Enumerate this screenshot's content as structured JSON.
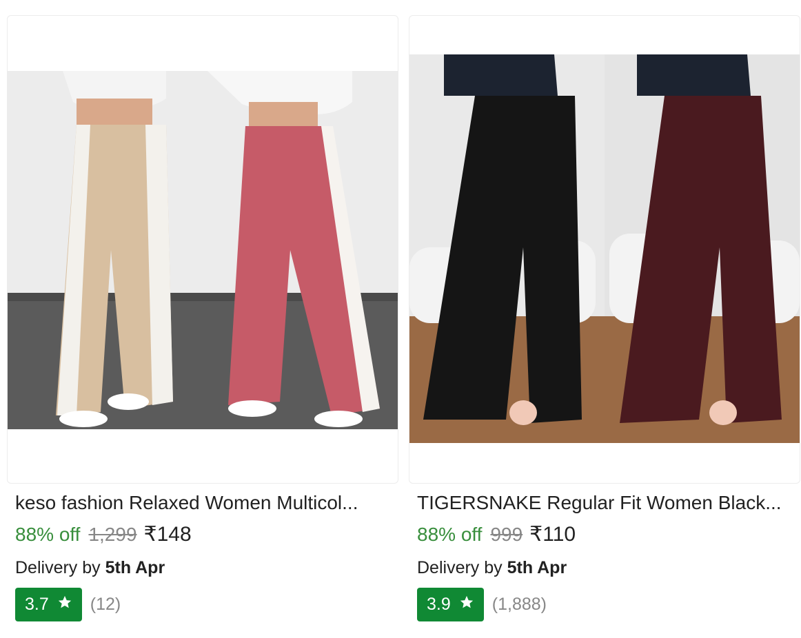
{
  "products": [
    {
      "title": "keso fashion Relaxed Women Multicol...",
      "discount": "88% off",
      "mrp": "1,299",
      "price": "₹148",
      "delivery_prefix": "Delivery by",
      "delivery_date": "5th Apr",
      "rating": "3.7",
      "rating_count": "(12)",
      "image_icon": "product-image-icon"
    },
    {
      "title": "TIGERSNAKE Regular Fit Women Black...",
      "discount": "88% off",
      "mrp": "999",
      "price": "₹110",
      "delivery_prefix": "Delivery by",
      "delivery_date": "5th Apr",
      "rating": "3.9",
      "rating_count": "(1,888)",
      "image_icon": "product-image-icon"
    }
  ],
  "colors": {
    "discount": "#388e3c",
    "rating_badge": "#108934",
    "muted": "#878787",
    "text": "#212121"
  }
}
